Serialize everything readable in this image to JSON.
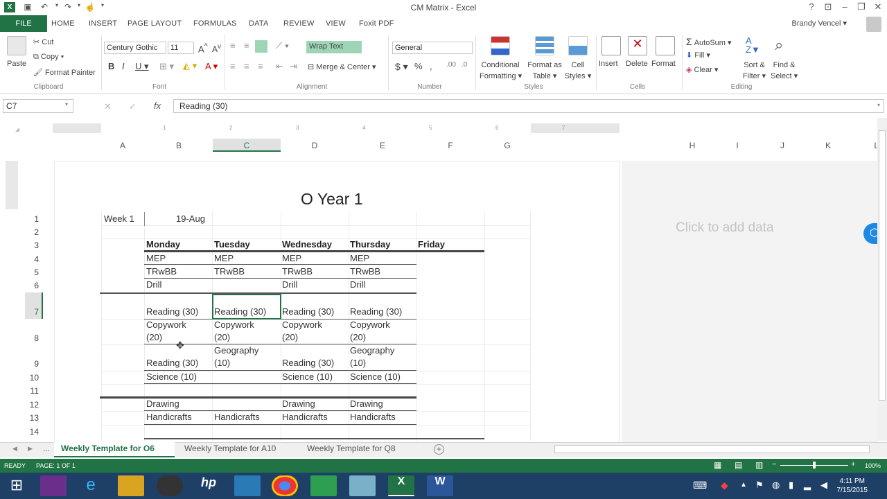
{
  "window": {
    "title": "CM Matrix - Excel",
    "user": "Brandy Vencel"
  },
  "tabs": {
    "file": "FILE",
    "home": "HOME",
    "insert": "INSERT",
    "page_layout": "PAGE LAYOUT",
    "formulas": "FORMULAS",
    "data": "DATA",
    "review": "REVIEW",
    "view": "VIEW",
    "foxit": "Foxit PDF"
  },
  "ribbon": {
    "clipboard": {
      "paste": "Paste",
      "cut": "Cut",
      "copy": "Copy",
      "format_painter": "Format Painter",
      "group": "Clipboard"
    },
    "font": {
      "name": "Century Gothic",
      "size": "11",
      "group": "Font"
    },
    "alignment": {
      "wrap_text": "Wrap Text",
      "merge_center": "Merge & Center",
      "group": "Alignment"
    },
    "number": {
      "format": "General",
      "group": "Number"
    },
    "styles": {
      "conditional": "Conditional",
      "conditional2": "Formatting",
      "format_as": "Format as",
      "format_as2": "Table",
      "cell": "Cell",
      "cell2": "Styles",
      "group": "Styles"
    },
    "cells": {
      "insert": "Insert",
      "delete": "Delete",
      "format": "Format",
      "group": "Cells"
    },
    "editing": {
      "autosum": "AutoSum",
      "fill": "Fill",
      "clear": "Clear",
      "sort": "Sort &",
      "sort2": "Filter",
      "find": "Find &",
      "find2": "Select",
      "group": "Editing"
    }
  },
  "formula_bar": {
    "name_box": "C7",
    "fx": "fx",
    "value": "Reading (30)"
  },
  "ruler": [
    "1",
    "2",
    "3",
    "4",
    "5",
    "6",
    "7"
  ],
  "columns": [
    "A",
    "B",
    "C",
    "D",
    "E",
    "F",
    "G",
    "H",
    "I",
    "J",
    "K",
    "L"
  ],
  "rows": [
    "1",
    "2",
    "3",
    "4",
    "5",
    "6",
    "7",
    "8",
    "9",
    "10",
    "11",
    "12",
    "13",
    "14"
  ],
  "sheet": {
    "title": "O Year 1",
    "week_label": "Week 1",
    "week_date": "19-Aug",
    "days": [
      "Monday",
      "Tuesday",
      "Wednesday",
      "Thursday",
      "Friday"
    ],
    "mep": [
      "MEP",
      "MEP",
      "MEP",
      "MEP"
    ],
    "trwbb": [
      "TRwBB",
      "TRwBB",
      "TRwBB",
      "TRwBB"
    ],
    "drill": [
      "Drill",
      "",
      "Drill",
      "Drill"
    ],
    "reading": [
      "Reading (30)",
      "Reading (30)",
      "Reading (30)",
      "Reading (30)"
    ],
    "copywork_1": [
      "Copywork",
      "Copywork",
      "Copywork",
      "Copywork"
    ],
    "copywork_2": [
      "(20)",
      "(20)",
      "(20)",
      "(20)"
    ],
    "r9_top": [
      "",
      "Geography",
      "",
      "Geography"
    ],
    "r9_bottom": [
      "Reading (30)",
      "(10)",
      "Reading (30)",
      "(10)"
    ],
    "science": [
      "Science (10)",
      "",
      "Science (10)",
      "Science (10)"
    ],
    "drawing": [
      "Drawing",
      "",
      "Drawing",
      "Drawing"
    ],
    "handicrafts": [
      "Handicrafts",
      "Handicrafts",
      "Handicrafts",
      "Handicrafts"
    ],
    "right_placeholder": "Click to add data"
  },
  "sheet_tabs": {
    "more": "...",
    "active": "Weekly Template for O6",
    "tab2": "Weekly Template for A10",
    "tab3": "Weekly Template for Q8"
  },
  "status": {
    "ready": "READY",
    "page": "PAGE: 1 OF 1",
    "zoom": "100%"
  },
  "clock": {
    "time": "4:11 PM",
    "date": "7/15/2015"
  },
  "colors": {
    "excel_green": "#217346",
    "taskbar": "#1e3f66"
  }
}
